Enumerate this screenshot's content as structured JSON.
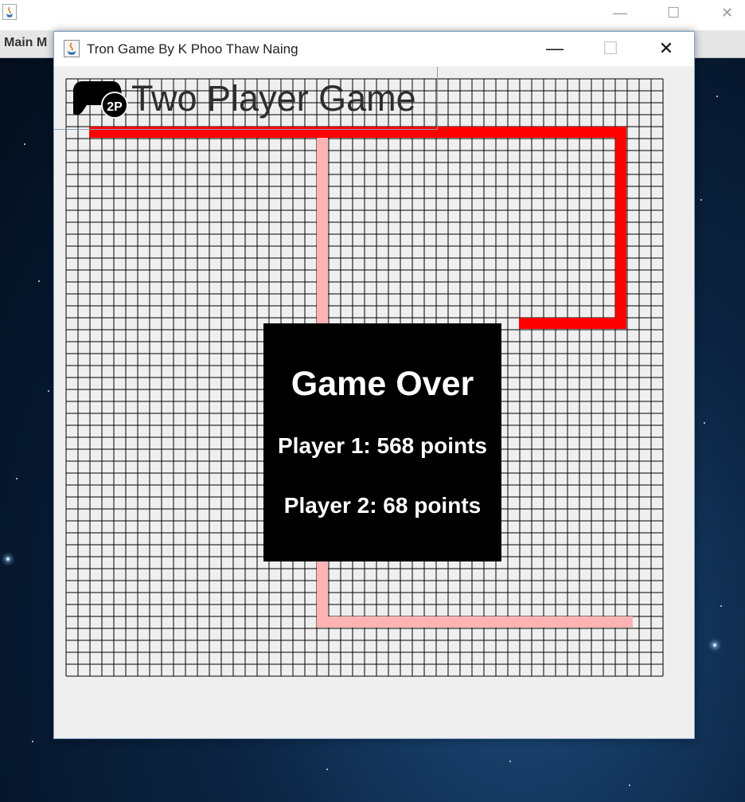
{
  "background_window": {
    "menu_label": "Main M",
    "controls": [
      "—",
      "☐",
      "✕"
    ]
  },
  "window": {
    "title": "Tron Game By K Phoo Thaw Naing",
    "controls": {
      "minimize": "—",
      "maximize": "☐",
      "close": "✕"
    }
  },
  "header": {
    "title": "Two Player Game",
    "badge": "2P",
    "icon": "gamepad-icon"
  },
  "board": {
    "cols": 50,
    "rows": 50,
    "grid_color": "#000000",
    "cell_color": "#efefef"
  },
  "players": [
    {
      "name": "Player 1",
      "color": "#ff0000",
      "points": 568
    },
    {
      "name": "Player 2",
      "color": "#ffb3b3",
      "points": 68
    }
  ],
  "game_over": {
    "title": "Game Over",
    "player1_text": "Player 1: 568 points",
    "player2_text": "Player 2: 68 points"
  },
  "colors": {
    "player1_trail": "#ff0000",
    "player2_trail": "#ffb3b3",
    "overlay": "#000000"
  }
}
